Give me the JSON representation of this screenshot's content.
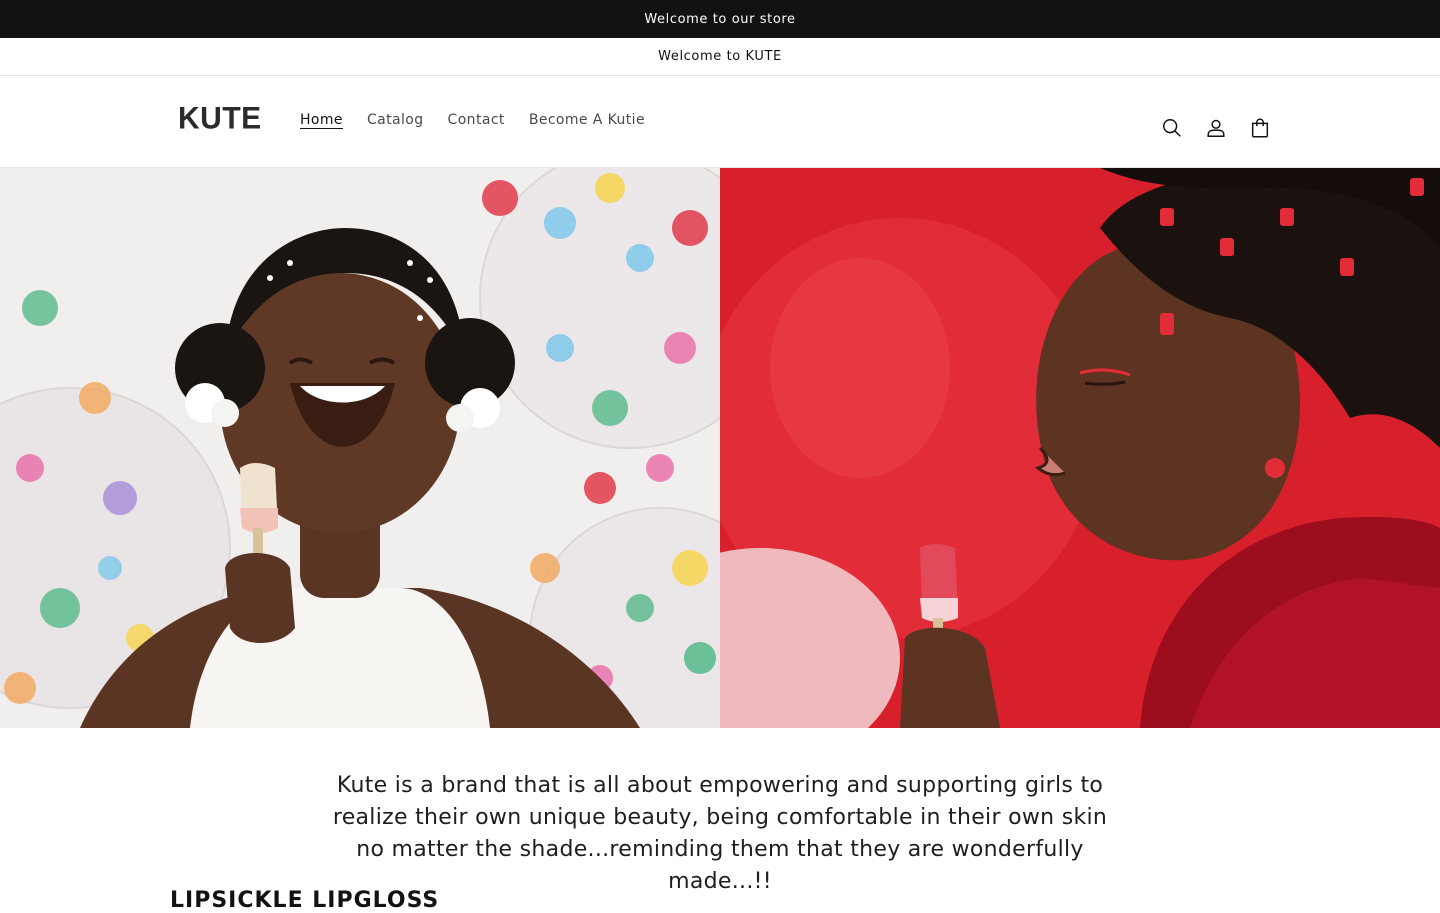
{
  "announcements": {
    "primary": "Welcome to our store",
    "secondary": "Welcome to KUTE"
  },
  "header": {
    "logo": "KUTE",
    "nav": [
      {
        "label": "Home",
        "active": true
      },
      {
        "label": "Catalog",
        "active": false
      },
      {
        "label": "Contact",
        "active": false
      },
      {
        "label": "Become A Kutie",
        "active": false
      }
    ],
    "icons": [
      "search-icon",
      "account-icon",
      "cart-icon"
    ]
  },
  "hero": {
    "left_image": "girl-with-popsicle-lip-gloss-confetti-balloons",
    "right_image": "girl-with-popsicle-lip-gloss-red-balloon"
  },
  "statement": "Kute is a brand that is all about empowering and supporting girls to realize their own unique beauty, being comfortable in their own skin no matter the shade...reminding them that they are wonderfully made...!!",
  "next_section": {
    "heading": "LIPSICKLE LIPGLOSS"
  },
  "colors": {
    "announcement_bg": "#121212",
    "text": "#121212",
    "accent_red": "#d7263d"
  }
}
